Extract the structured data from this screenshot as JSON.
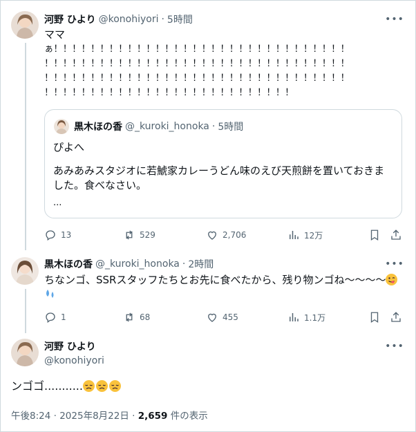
{
  "tweet1": {
    "name": "河野 ひより",
    "handle": "@konohiyori",
    "time": "5時間",
    "line1": "ママ",
    "bangs": [
      "ぁ！！！！！！！！！！！！！！！！！！！！！！！！！！！！！！！！",
      "！！！！！！！！！！！！！！！！！！！！！！！！！！！！！！！！！",
      "！！！！！！！！！！！！！！！！！！！！！！！！！！！！！！！！！",
      "！！！！！！！！！！！！！！！！！！！！！！！！！！！！！！！！！",
      "！！！！！！！！！！！！！！！！！！！！！！！！！！！"
    ],
    "quote": {
      "name": "黒木ほの香",
      "handle": "@_kuroki_honoka",
      "time": "5時間",
      "line1": "ぴよへ",
      "line2": "あみあみスタジオに若鯱家カレーうどん味のえび天煎餅を置いておきま",
      "line3": "した。食べなさい。",
      "line4": "..."
    },
    "stats": {
      "replies": "13",
      "reposts": "529",
      "likes": "2,706",
      "views": "12万"
    }
  },
  "tweet2": {
    "name": "黒木ほの香",
    "handle": "@_kuroki_honoka",
    "time": "2時間",
    "text": "ちなンゴ、SSRスタッフたちとお先に食べたから、残り物ンゴね〜〜〜〜",
    "stats": {
      "replies": "1",
      "reposts": "68",
      "likes": "455",
      "views": "1.1万"
    }
  },
  "main": {
    "name": "河野 ひより",
    "handle": "@konohiyori",
    "text": "ンゴゴ...........",
    "time": "午後8:24",
    "date": "2025年8月22日",
    "views_count": "2,659",
    "views_label": "件の表示"
  },
  "icons": [
    "more-icon",
    "reply-icon",
    "repost-icon",
    "like-icon",
    "views-icon",
    "bookmark-icon",
    "share-icon",
    "yum-emoji",
    "sweat-emoji",
    "disappointed-emoji"
  ],
  "colors": {
    "text": "#0f1419",
    "secondary": "#536471",
    "border": "#cfd9de",
    "emoji": "#f9c23c"
  }
}
